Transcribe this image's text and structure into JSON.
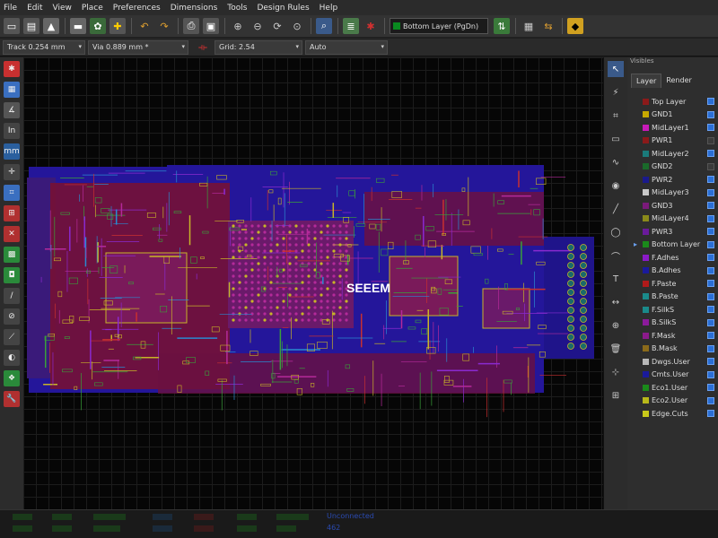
{
  "menu": [
    "File",
    "Edit",
    "View",
    "Place",
    "Preferences",
    "Dimensions",
    "Tools",
    "Design Rules",
    "Help"
  ],
  "toolbar": {
    "active_layer": "Bottom Layer (PgDn)"
  },
  "options": {
    "track": "Track 0.254 mm",
    "via": "Via 0.889 mm *",
    "grid": "Grid: 2.54",
    "zoom": "Auto"
  },
  "left_tools": [
    {
      "icon": "drc-icon",
      "color": "#c83030",
      "glyph": "✱"
    },
    {
      "icon": "grid-icon",
      "color": "#3a6fc0",
      "glyph": "▦"
    },
    {
      "icon": "polar-coords-icon",
      "color": "#555",
      "glyph": "∡"
    },
    {
      "icon": "inch-units-icon",
      "color": "#444",
      "glyph": "In"
    },
    {
      "icon": "mm-units-icon",
      "color": "#2a5f9e",
      "glyph": "mm"
    },
    {
      "icon": "cursor-shape-icon",
      "color": "#444",
      "glyph": "✛"
    },
    {
      "icon": "ratsnest-icon",
      "color": "#3a6fc0",
      "glyph": "⌗"
    },
    {
      "icon": "module-ratsnest-icon",
      "color": "#b03030",
      "glyph": "⊞"
    },
    {
      "icon": "auto-delete-track-icon",
      "color": "#b03030",
      "glyph": "✕"
    },
    {
      "icon": "zone-fill-icon",
      "color": "#2a8a3a",
      "glyph": "▩"
    },
    {
      "icon": "zone-outline-icon",
      "color": "#2a8a3a",
      "glyph": "◘"
    },
    {
      "icon": "pad-sketch-icon",
      "color": "#444",
      "glyph": "/"
    },
    {
      "icon": "via-sketch-icon",
      "color": "#444",
      "glyph": "⊘"
    },
    {
      "icon": "track-sketch-icon",
      "color": "#444",
      "glyph": "⟋"
    },
    {
      "icon": "high-contrast-icon",
      "color": "#444",
      "glyph": "◐"
    },
    {
      "icon": "layer-manager-icon",
      "color": "#2a8a3a",
      "glyph": "❖"
    },
    {
      "icon": "microwave-tools-icon",
      "color": "#b03030",
      "glyph": "🔧"
    }
  ],
  "right_tools": [
    {
      "icon": "select-arrow-icon",
      "glyph": "↖"
    },
    {
      "icon": "highlight-net-icon",
      "glyph": "⚡"
    },
    {
      "icon": "local-ratsnest-icon",
      "glyph": "⌗"
    },
    {
      "icon": "add-module-icon",
      "glyph": "▭"
    },
    {
      "icon": "add-track-icon",
      "glyph": "∿"
    },
    {
      "icon": "add-via-icon",
      "glyph": "◉"
    },
    {
      "icon": "add-line-icon",
      "glyph": "╱"
    },
    {
      "icon": "add-circle-icon",
      "glyph": "◯"
    },
    {
      "icon": "add-arc-icon",
      "glyph": "⌒"
    },
    {
      "icon": "add-text-icon",
      "glyph": "T"
    },
    {
      "icon": "add-dimension-icon",
      "glyph": "↔"
    },
    {
      "icon": "add-target-icon",
      "glyph": "⊕"
    },
    {
      "icon": "delete-icon",
      "glyph": "🗑"
    },
    {
      "icon": "set-origin-icon",
      "glyph": "⊹"
    },
    {
      "icon": "grid-origin-icon",
      "glyph": "⊞"
    }
  ],
  "panel": {
    "title": "Visibles",
    "tabs": [
      "Layer",
      "Render"
    ]
  },
  "layers": [
    {
      "name": "Top Layer",
      "color": "#8b1a1a",
      "on": true
    },
    {
      "name": "GND1",
      "color": "#c8a800",
      "on": true
    },
    {
      "name": "MidLayer1",
      "color": "#c81ab8",
      "on": true
    },
    {
      "name": "PWR1",
      "color": "#8b1a1a",
      "on": false
    },
    {
      "name": "MidLayer2",
      "color": "#1a7a7a",
      "on": true
    },
    {
      "name": "GND2",
      "color": "#1a6a2a",
      "on": false
    },
    {
      "name": "PWR2",
      "color": "#1a1a8b",
      "on": true
    },
    {
      "name": "MidLayer3",
      "color": "#c8c8c8",
      "on": true
    },
    {
      "name": "GND3",
      "color": "#7a1a7a",
      "on": true
    },
    {
      "name": "MidLayer4",
      "color": "#8a8a1a",
      "on": true
    },
    {
      "name": "PWR3",
      "color": "#6a1a9b",
      "on": true
    },
    {
      "name": "Bottom Layer",
      "color": "#1a8a1a",
      "on": true,
      "active": true
    },
    {
      "name": "F.Adhes",
      "color": "#8b1ac8",
      "on": true
    },
    {
      "name": "B.Adhes",
      "color": "#1a1a9b",
      "on": true
    },
    {
      "name": "F.Paste",
      "color": "#b01a1a",
      "on": true
    },
    {
      "name": "B.Paste",
      "color": "#1a8a8a",
      "on": true
    },
    {
      "name": "F.SilkS",
      "color": "#1a8a8a",
      "on": true
    },
    {
      "name": "B.SilkS",
      "color": "#8b1a9b",
      "on": true
    },
    {
      "name": "F.Mask",
      "color": "#8b1a8b",
      "on": true
    },
    {
      "name": "B.Mask",
      "color": "#8b6a1a",
      "on": true
    },
    {
      "name": "Dwgs.User",
      "color": "#b8b8b8",
      "on": true
    },
    {
      "name": "Cmts.User",
      "color": "#1a1a9b",
      "on": true
    },
    {
      "name": "Eco1.User",
      "color": "#1a8a1a",
      "on": true
    },
    {
      "name": "Eco2.User",
      "color": "#b8b81a",
      "on": true
    },
    {
      "name": "Edge.Cuts",
      "color": "#c8c81a",
      "on": true
    }
  ],
  "board": {
    "silk_label": "SEEEM"
  },
  "status": {
    "unconnected_label": "Unconnected",
    "unconnected_value": "462"
  },
  "colors": {
    "board_blue": "#2a1a9e",
    "copper_red": "#8b1428",
    "trace_magenta": "#b42a9a",
    "silk_yellow": "#c8b428",
    "silk_green": "#3aa03a"
  }
}
